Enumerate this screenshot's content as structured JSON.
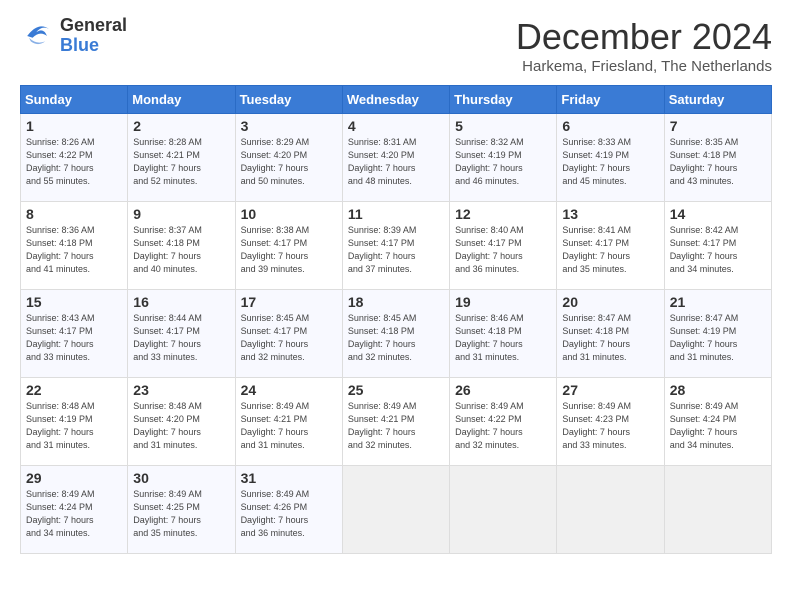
{
  "logo": {
    "general": "General",
    "blue": "Blue"
  },
  "title": "December 2024",
  "subtitle": "Harkema, Friesland, The Netherlands",
  "days_of_week": [
    "Sunday",
    "Monday",
    "Tuesday",
    "Wednesday",
    "Thursday",
    "Friday",
    "Saturday"
  ],
  "weeks": [
    [
      {
        "day": 1,
        "info": "Sunrise: 8:26 AM\nSunset: 4:22 PM\nDaylight: 7 hours\nand 55 minutes."
      },
      {
        "day": 2,
        "info": "Sunrise: 8:28 AM\nSunset: 4:21 PM\nDaylight: 7 hours\nand 52 minutes."
      },
      {
        "day": 3,
        "info": "Sunrise: 8:29 AM\nSunset: 4:20 PM\nDaylight: 7 hours\nand 50 minutes."
      },
      {
        "day": 4,
        "info": "Sunrise: 8:31 AM\nSunset: 4:20 PM\nDaylight: 7 hours\nand 48 minutes."
      },
      {
        "day": 5,
        "info": "Sunrise: 8:32 AM\nSunset: 4:19 PM\nDaylight: 7 hours\nand 46 minutes."
      },
      {
        "day": 6,
        "info": "Sunrise: 8:33 AM\nSunset: 4:19 PM\nDaylight: 7 hours\nand 45 minutes."
      },
      {
        "day": 7,
        "info": "Sunrise: 8:35 AM\nSunset: 4:18 PM\nDaylight: 7 hours\nand 43 minutes."
      }
    ],
    [
      {
        "day": 8,
        "info": "Sunrise: 8:36 AM\nSunset: 4:18 PM\nDaylight: 7 hours\nand 41 minutes."
      },
      {
        "day": 9,
        "info": "Sunrise: 8:37 AM\nSunset: 4:18 PM\nDaylight: 7 hours\nand 40 minutes."
      },
      {
        "day": 10,
        "info": "Sunrise: 8:38 AM\nSunset: 4:17 PM\nDaylight: 7 hours\nand 39 minutes."
      },
      {
        "day": 11,
        "info": "Sunrise: 8:39 AM\nSunset: 4:17 PM\nDaylight: 7 hours\nand 37 minutes."
      },
      {
        "day": 12,
        "info": "Sunrise: 8:40 AM\nSunset: 4:17 PM\nDaylight: 7 hours\nand 36 minutes."
      },
      {
        "day": 13,
        "info": "Sunrise: 8:41 AM\nSunset: 4:17 PM\nDaylight: 7 hours\nand 35 minutes."
      },
      {
        "day": 14,
        "info": "Sunrise: 8:42 AM\nSunset: 4:17 PM\nDaylight: 7 hours\nand 34 minutes."
      }
    ],
    [
      {
        "day": 15,
        "info": "Sunrise: 8:43 AM\nSunset: 4:17 PM\nDaylight: 7 hours\nand 33 minutes."
      },
      {
        "day": 16,
        "info": "Sunrise: 8:44 AM\nSunset: 4:17 PM\nDaylight: 7 hours\nand 33 minutes."
      },
      {
        "day": 17,
        "info": "Sunrise: 8:45 AM\nSunset: 4:17 PM\nDaylight: 7 hours\nand 32 minutes."
      },
      {
        "day": 18,
        "info": "Sunrise: 8:45 AM\nSunset: 4:18 PM\nDaylight: 7 hours\nand 32 minutes."
      },
      {
        "day": 19,
        "info": "Sunrise: 8:46 AM\nSunset: 4:18 PM\nDaylight: 7 hours\nand 31 minutes."
      },
      {
        "day": 20,
        "info": "Sunrise: 8:47 AM\nSunset: 4:18 PM\nDaylight: 7 hours\nand 31 minutes."
      },
      {
        "day": 21,
        "info": "Sunrise: 8:47 AM\nSunset: 4:19 PM\nDaylight: 7 hours\nand 31 minutes."
      }
    ],
    [
      {
        "day": 22,
        "info": "Sunrise: 8:48 AM\nSunset: 4:19 PM\nDaylight: 7 hours\nand 31 minutes."
      },
      {
        "day": 23,
        "info": "Sunrise: 8:48 AM\nSunset: 4:20 PM\nDaylight: 7 hours\nand 31 minutes."
      },
      {
        "day": 24,
        "info": "Sunrise: 8:49 AM\nSunset: 4:21 PM\nDaylight: 7 hours\nand 31 minutes."
      },
      {
        "day": 25,
        "info": "Sunrise: 8:49 AM\nSunset: 4:21 PM\nDaylight: 7 hours\nand 32 minutes."
      },
      {
        "day": 26,
        "info": "Sunrise: 8:49 AM\nSunset: 4:22 PM\nDaylight: 7 hours\nand 32 minutes."
      },
      {
        "day": 27,
        "info": "Sunrise: 8:49 AM\nSunset: 4:23 PM\nDaylight: 7 hours\nand 33 minutes."
      },
      {
        "day": 28,
        "info": "Sunrise: 8:49 AM\nSunset: 4:24 PM\nDaylight: 7 hours\nand 34 minutes."
      }
    ],
    [
      {
        "day": 29,
        "info": "Sunrise: 8:49 AM\nSunset: 4:24 PM\nDaylight: 7 hours\nand 34 minutes."
      },
      {
        "day": 30,
        "info": "Sunrise: 8:49 AM\nSunset: 4:25 PM\nDaylight: 7 hours\nand 35 minutes."
      },
      {
        "day": 31,
        "info": "Sunrise: 8:49 AM\nSunset: 4:26 PM\nDaylight: 7 hours\nand 36 minutes."
      },
      null,
      null,
      null,
      null
    ]
  ]
}
